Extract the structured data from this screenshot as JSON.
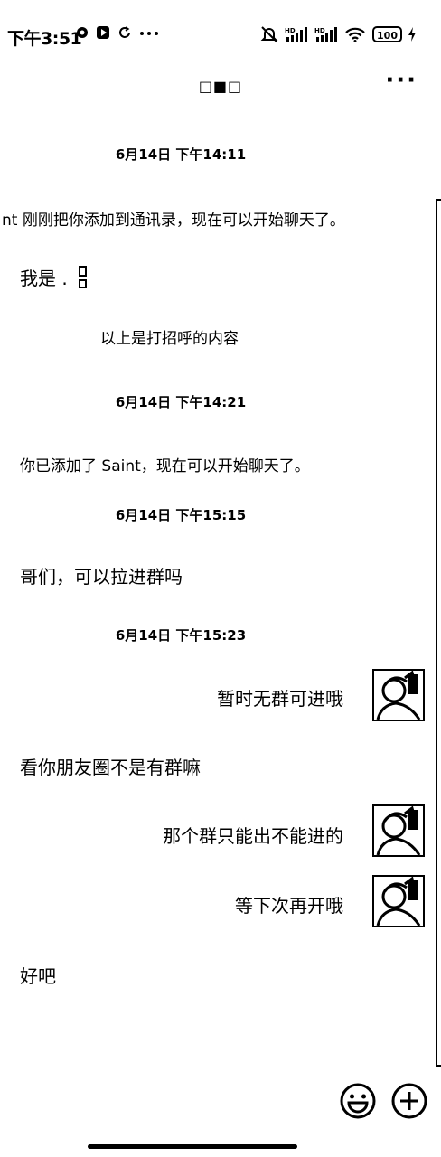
{
  "status_bar": {
    "time": "下午3:51",
    "battery": "100",
    "icons": [
      "vpn-icon",
      "media-icon",
      "refresh-icon",
      "dots-icon",
      "silent-icon",
      "signal-hd-icon",
      "signal-hd-icon",
      "wifi-icon",
      "battery-icon",
      "charging-icon"
    ]
  },
  "header": {
    "title": "□■□",
    "more": "···"
  },
  "messages": [
    {
      "kind": "timestamp",
      "text": "6月14日 下午14:11"
    },
    {
      "kind": "system",
      "text": "nt 刚刚把你添加到通讯录，现在可以开始聊天了。"
    },
    {
      "kind": "left",
      "text": "我是 ."
    },
    {
      "kind": "system",
      "text": "以上是打招呼的内容"
    },
    {
      "kind": "timestamp",
      "text": "6月14日 下午14:21"
    },
    {
      "kind": "system",
      "text": "你已添加了 Saint，现在可以开始聊天了。"
    },
    {
      "kind": "timestamp",
      "text": "6月14日 下午15:15"
    },
    {
      "kind": "left",
      "text": "哥们，可以拉进群吗"
    },
    {
      "kind": "timestamp",
      "text": "6月14日 下午15:23"
    },
    {
      "kind": "right",
      "text": "暂时无群可进哦"
    },
    {
      "kind": "left",
      "text": "看你朋友圈不是有群嘛"
    },
    {
      "kind": "right",
      "text": "那个群只能出不能进的"
    },
    {
      "kind": "right",
      "text": "等下次再开哦"
    },
    {
      "kind": "left",
      "text": "好吧"
    }
  ],
  "input_bar": {
    "icons": [
      "emoji-icon",
      "plus-icon"
    ]
  }
}
